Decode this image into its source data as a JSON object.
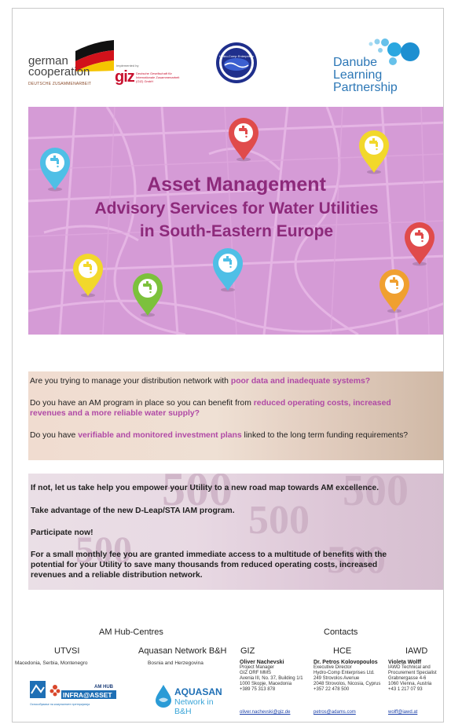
{
  "logos": {
    "german_line1": "german",
    "german_line2": "cooperation",
    "german_sub": "DEUTSCHE ZUSAMMENARBEIT",
    "giz_small": "Implemented by",
    "giz_mark": "giz",
    "giz_desc": "Deutsche Gesellschaft für Internationale Zusammenarbeit (GIZ) GmbH",
    "hce_text": "Hydro-Comp Enterprises",
    "dlp_line1": "Danube",
    "dlp_line2": "Learning",
    "dlp_line3": "Partnership",
    "colors": {
      "giz_red": "#c8102e",
      "dlp_blue": "#2c77b6"
    }
  },
  "banner": {
    "title": "Asset Management",
    "line2": "Advisory Services for Water Utilities",
    "line3": "in South-Eastern Europe",
    "colors": {
      "background": "#d59bd6",
      "text": "#8d2a7b"
    },
    "pins": [
      {
        "color": "#4fbfe6",
        "icon": "water-tap-icon"
      },
      {
        "color": "#e04b4b",
        "icon": "water-tap-icon"
      },
      {
        "color": "#f2d82b",
        "icon": "water-tap-icon"
      },
      {
        "color": "#e04b4b",
        "icon": "water-tap-icon"
      },
      {
        "color": "#f2d82b",
        "icon": "water-tap-icon"
      },
      {
        "color": "#7cc13c",
        "icon": "water-tap-icon"
      },
      {
        "color": "#4fbfe6",
        "icon": "water-tap-icon"
      },
      {
        "color": "#f0a030",
        "icon": "water-tap-icon"
      }
    ]
  },
  "questions": {
    "q1_pre": "Are you trying to manage your distribution network with ",
    "q1_hl": "poor data and inadequate systems?",
    "q2_pre": "Do you have an AM program in place so you can benefit from ",
    "q2_hl": "reduced operating costs, increased",
    "q2_hl2": "revenues and a more reliable water supply?",
    "q3_pre": "Do you have ",
    "q3_hl": "verifiable and monitored investment plans",
    "q3_post": " linked to the long term funding requirements?",
    "highlight_color": "#b04aa6"
  },
  "answers": {
    "a1": "If not, let us take help you empower your Utility to a new road map towards AM excellence.",
    "a2": "Take advantage of the new D-Leap/STA IAM program.",
    "a3": "Participate now!",
    "a4_line1": "For a small monthly fee you are granted immediate access to a multitude of benefits with the",
    "a4_line2": "potential for your Utility to save many thousands from reduced operating costs, increased",
    "a4_line3": "revenues and a reliable distribution network.",
    "watermark": "500"
  },
  "footer": {
    "hubs_title": "AM Hub-Centres",
    "contacts_title": "Contacts",
    "hubs": [
      {
        "name": "UTVSI",
        "region": "Macedonia, Serbia, Montenegro"
      },
      {
        "name": "Aquasan Network B&H",
        "region": "Bosnia and Herzegovina"
      }
    ],
    "infra_logo": {
      "text1": "AM HUB",
      "text2": "INFRA@ASSET",
      "tagline": "Оспособување на комуналните претпријатија"
    },
    "aquasan_logo": {
      "name": "AQUASAN",
      "sub": "Network in B&H"
    },
    "contacts": [
      {
        "org": "GIZ",
        "name": "Oliver Nachevski",
        "lines": [
          "Project Manager",
          "GIZ ORF MMS",
          "Avenia III, No. 37, Building 1/1",
          "1000 Skopje, Macedonia",
          "+389 75 313 878"
        ],
        "email": "oliver.nachevski@giz.de"
      },
      {
        "org": "HCE",
        "name": "Dr. Petros Kolovopoulos",
        "lines": [
          "Executive Director",
          "Hydro-Comp Enterprises Ltd.",
          "249 Strovolos Avenue",
          "2048 Strovolos, Nicosia, Cyprus",
          "+357 22 478 500"
        ],
        "email": "petros@adams.com"
      },
      {
        "org": "IAWD",
        "name": "Violeta Wolff",
        "lines": [
          "IAWD Technical and",
          "Procurement Specialist",
          "Grabnergasse 4-6",
          "1060 Vienna, Austria",
          "+43 1 217 07 93"
        ],
        "email": "wolff@iawd.at"
      }
    ]
  }
}
